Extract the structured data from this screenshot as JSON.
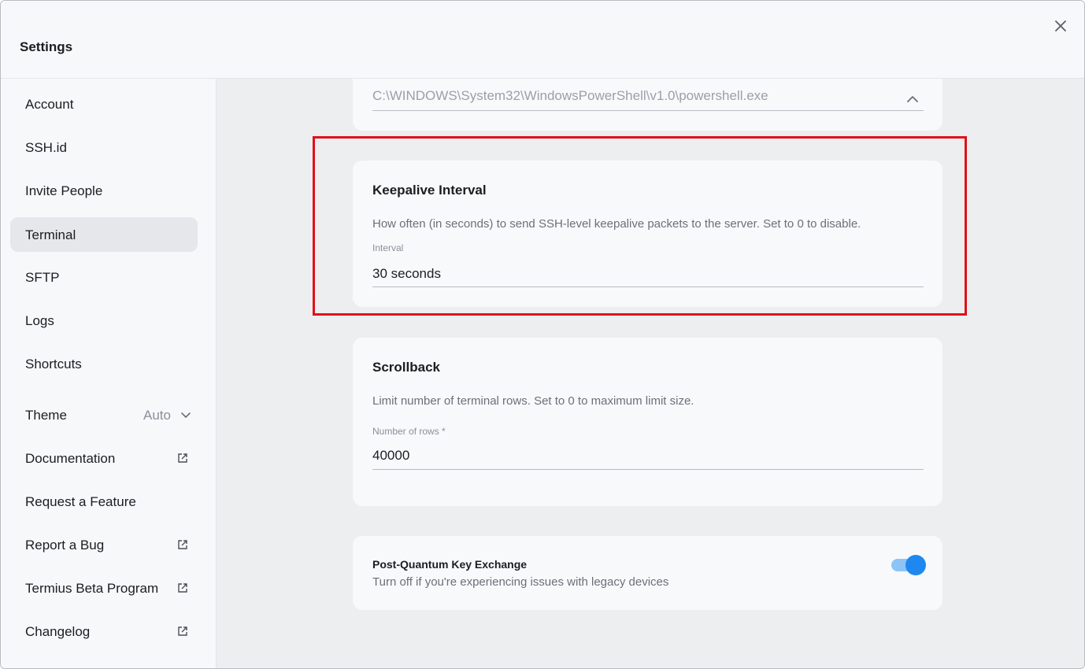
{
  "header": {
    "title": "Settings"
  },
  "sidebar": {
    "items": [
      {
        "label": "Account"
      },
      {
        "label": "SSH.id"
      },
      {
        "label": "Invite People"
      },
      {
        "label": "Terminal"
      },
      {
        "label": "SFTP"
      },
      {
        "label": "Logs"
      },
      {
        "label": "Shortcuts"
      },
      {
        "label": "Theme",
        "value": "Auto"
      },
      {
        "label": "Documentation"
      },
      {
        "label": "Request a Feature"
      },
      {
        "label": "Report a Bug"
      },
      {
        "label": "Termius Beta Program"
      },
      {
        "label": "Changelog"
      }
    ],
    "active": "Terminal"
  },
  "shell_path": {
    "value": "C:\\WINDOWS\\System32\\WindowsPowerShell\\v1.0\\powershell.exe"
  },
  "keepalive": {
    "title": "Keepalive Interval",
    "description": "How often (in seconds) to send SSH-level keepalive packets to the server. Set to 0 to disable.",
    "field_label": "Interval",
    "value": "30 seconds"
  },
  "scrollback": {
    "title": "Scrollback",
    "description": "Limit number of terminal rows. Set to 0 to maximum limit size.",
    "field_label": "Number of rows *",
    "value": "40000"
  },
  "pq": {
    "title": "Post-Quantum Key Exchange",
    "description": "Turn off if you're experiencing issues with legacy devices",
    "enabled": true
  },
  "colors": {
    "accent": "#1e88f0",
    "highlight": "#e0101a"
  },
  "icons": {
    "close": "close-icon",
    "external": "external-link-icon",
    "chevron_up": "chevron-up-icon",
    "chevron_down": "chevron-down-icon"
  }
}
